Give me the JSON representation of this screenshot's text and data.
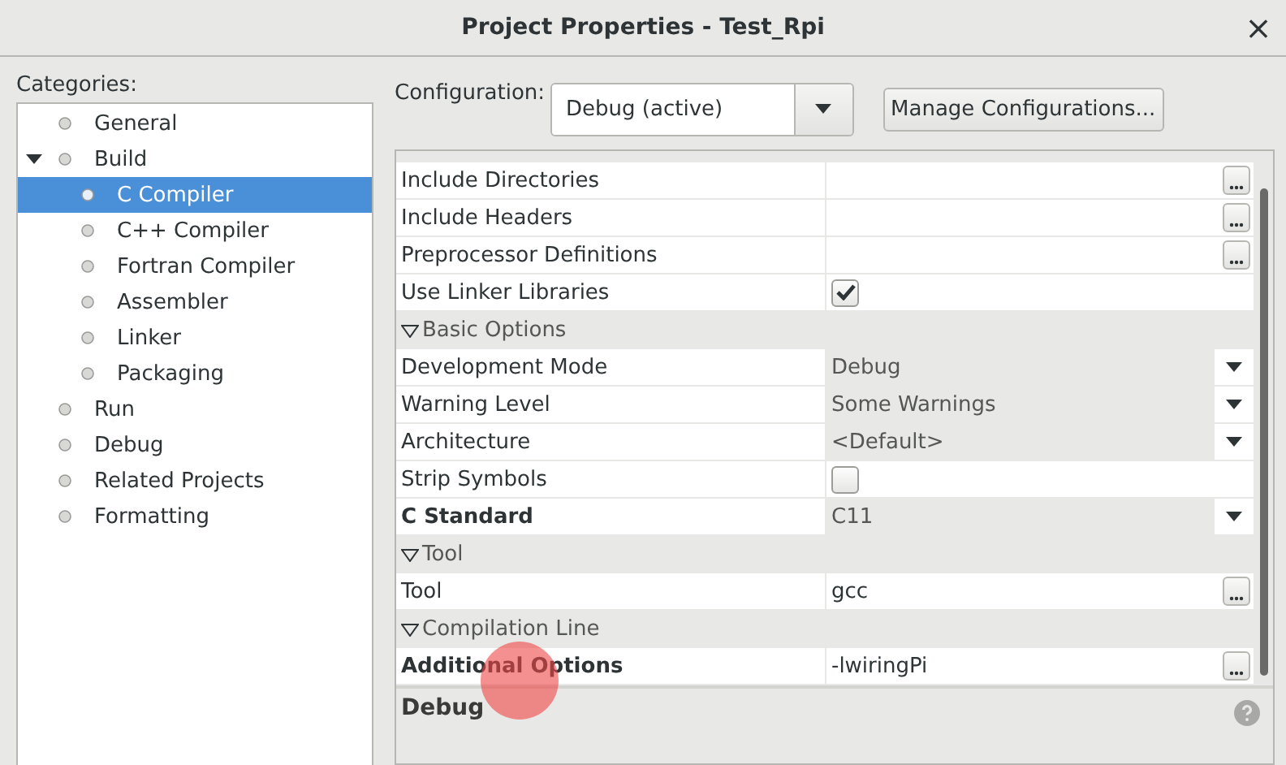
{
  "window": {
    "title": "Project Properties - Test_Rpi",
    "close": "×"
  },
  "categories": {
    "label": "Categories:",
    "items": [
      {
        "label": "General",
        "selected": false
      },
      {
        "label": "Build",
        "selected": false,
        "expanded": true,
        "children": [
          {
            "label": "C Compiler",
            "selected": true
          },
          {
            "label": "C++ Compiler",
            "selected": false
          },
          {
            "label": "Fortran Compiler",
            "selected": false
          },
          {
            "label": "Assembler",
            "selected": false
          },
          {
            "label": "Linker",
            "selected": false
          },
          {
            "label": "Packaging",
            "selected": false
          }
        ]
      },
      {
        "label": "Run",
        "selected": false
      },
      {
        "label": "Debug",
        "selected": false
      },
      {
        "label": "Related Projects",
        "selected": false
      },
      {
        "label": "Formatting",
        "selected": false
      }
    ]
  },
  "configuration": {
    "label": "Configuration:",
    "value": "Debug (active)",
    "manage_button": "Manage Configurations..."
  },
  "properties": [
    {
      "kind": "button",
      "label": "Include Directories",
      "bold": false
    },
    {
      "kind": "button",
      "label": "Include Headers",
      "bold": false
    },
    {
      "kind": "button",
      "label": "Preprocessor Definitions",
      "bold": false
    },
    {
      "kind": "checkbox",
      "label": "Use Linker Libraries",
      "bold": false,
      "checked": true
    },
    {
      "kind": "section",
      "label": "Basic Options",
      "expanded": true
    },
    {
      "kind": "dropdown",
      "label": "Development Mode",
      "bold": false,
      "value": "Debug"
    },
    {
      "kind": "dropdown",
      "label": "Warning Level",
      "bold": false,
      "value": "Some Warnings"
    },
    {
      "kind": "dropdown",
      "label": "Architecture",
      "bold": false,
      "value": "<Default>"
    },
    {
      "kind": "checkbox",
      "label": "Strip Symbols",
      "bold": false,
      "checked": false
    },
    {
      "kind": "dropdown",
      "label": "C Standard",
      "bold": true,
      "value": "C11"
    },
    {
      "kind": "section",
      "label": "Tool",
      "expanded": true
    },
    {
      "kind": "button",
      "label": "Tool",
      "bold": false,
      "value": "gcc"
    },
    {
      "kind": "section",
      "label": "Compilation Line",
      "expanded": true
    },
    {
      "kind": "button",
      "label": "Additional Options",
      "bold": true,
      "value": "-lwiringPi"
    }
  ],
  "description": {
    "title": "Debug"
  }
}
